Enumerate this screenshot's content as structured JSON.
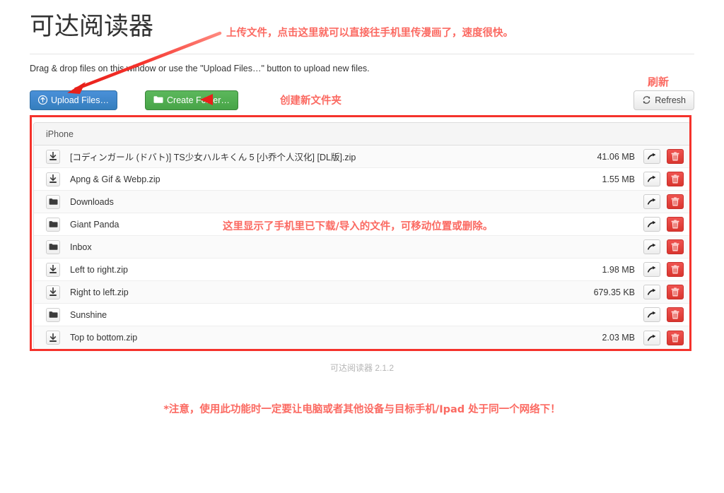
{
  "app": {
    "title": "可达阅读器",
    "version_footer": "可达阅读器 2.1.2",
    "drag_hint": "Drag & drop files on this window or use the \"Upload Files…\" button to upload new files."
  },
  "toolbar": {
    "upload_label": "Upload Files…",
    "upload_icon": "upload-circle-icon",
    "create_folder_label": "Create Folder…",
    "create_folder_icon": "folder-icon",
    "refresh_label": "Refresh",
    "refresh_icon": "refresh-icon"
  },
  "file_list": {
    "device_header": "iPhone",
    "rows": [
      {
        "icon": "download-file-icon",
        "kind": "file",
        "name": "[コディンガール (ドバト)] TS少女ハルキくん 5 [小乔个人汉化] [DL版].zip",
        "size": "41.06 MB",
        "move_icon": "arrow-move-icon",
        "delete_icon": "trash-icon"
      },
      {
        "icon": "download-file-icon",
        "kind": "file",
        "name": "Apng & Gif & Webp.zip",
        "size": "1.55 MB",
        "move_icon": "arrow-move-icon",
        "delete_icon": "trash-icon"
      },
      {
        "icon": "folder-icon",
        "kind": "folder",
        "name": "Downloads",
        "size": "",
        "move_icon": "arrow-move-icon",
        "delete_icon": "trash-icon"
      },
      {
        "icon": "folder-icon",
        "kind": "folder",
        "name": "Giant Panda",
        "size": "",
        "move_icon": "arrow-move-icon",
        "delete_icon": "trash-icon"
      },
      {
        "icon": "folder-icon",
        "kind": "folder",
        "name": "Inbox",
        "size": "",
        "move_icon": "arrow-move-icon",
        "delete_icon": "trash-icon"
      },
      {
        "icon": "download-file-icon",
        "kind": "file",
        "name": "Left to right.zip",
        "size": "1.98 MB",
        "move_icon": "arrow-move-icon",
        "delete_icon": "trash-icon"
      },
      {
        "icon": "download-file-icon",
        "kind": "file",
        "name": "Right to left.zip",
        "size": "679.35 KB",
        "move_icon": "arrow-move-icon",
        "delete_icon": "trash-icon"
      },
      {
        "icon": "folder-icon",
        "kind": "folder",
        "name": "Sunshine",
        "size": "",
        "move_icon": "arrow-move-icon",
        "delete_icon": "trash-icon"
      },
      {
        "icon": "download-file-icon",
        "kind": "file",
        "name": "Top to bottom.zip",
        "size": "2.03 MB",
        "move_icon": "arrow-move-icon",
        "delete_icon": "trash-icon"
      }
    ]
  },
  "annotations": {
    "upload": "上传文件，点击这里就可以直接往手机里传漫画了，速度很快。",
    "create_folder": "创建新文件夹",
    "refresh": "刷新",
    "file_list": "这里显示了手机里已下载/导入的文件，可移动位置或删除。",
    "warning": "*注意，使用此功能时一定要让电脑或者其他设备与目标手机/Ipad 处于同一个网络下！"
  },
  "colors": {
    "annotation_red": "#fb6a62",
    "highlight_box_red": "#f5322b",
    "upload_blue": "#3e8bcc",
    "create_green": "#51ae51",
    "delete_red": "#d9362f"
  }
}
